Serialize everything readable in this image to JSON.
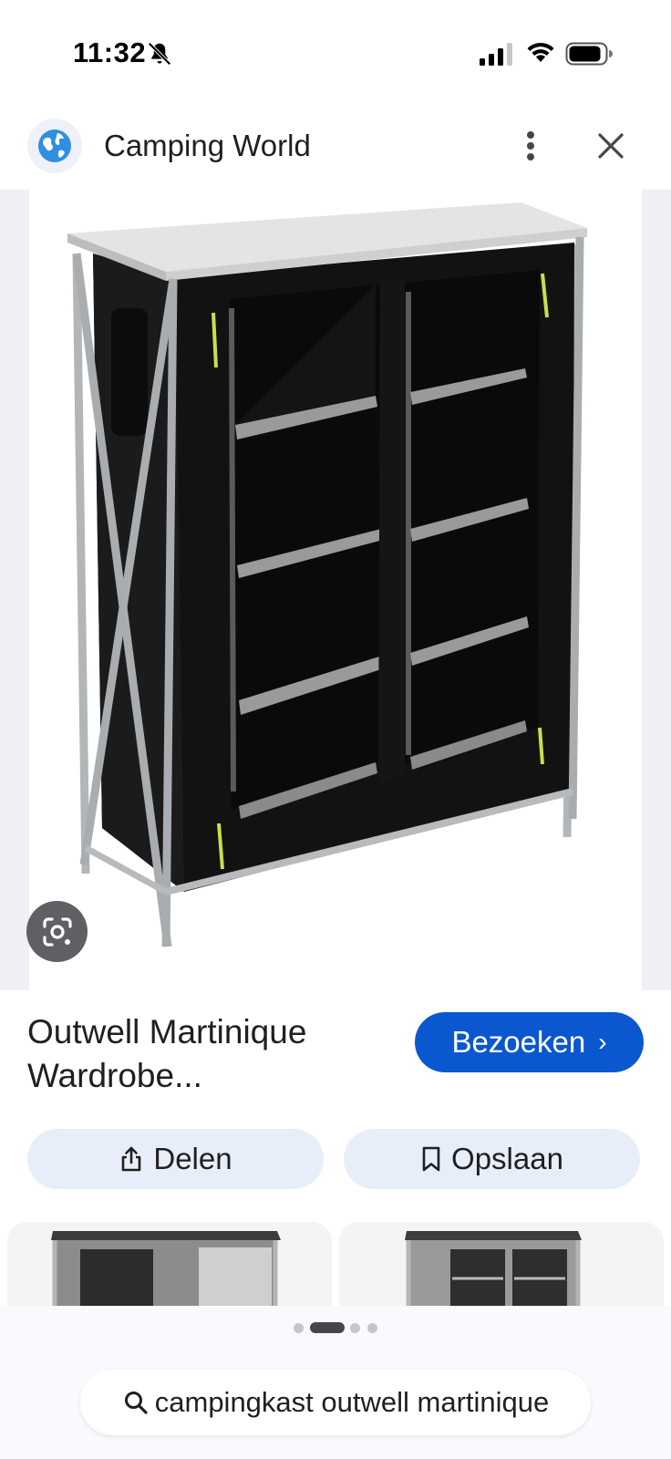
{
  "status_bar": {
    "time": "11:32",
    "icons": [
      "bell-slash-icon",
      "cellular-signal-icon",
      "wifi-icon",
      "battery-icon"
    ]
  },
  "header": {
    "site_name": "Camping World",
    "favicon_icon": "globe-icon",
    "more_icon": "more-vert-icon",
    "close_icon": "close-icon"
  },
  "image": {
    "lens_icon": "google-lens-icon"
  },
  "result": {
    "title": "Outwell Martinique Wardrobe...",
    "visit_label": "Bezoeken",
    "visit_chevron": "›",
    "share_label": "Delen",
    "save_label": "Opslaan"
  },
  "pager": {
    "count": 4,
    "active_index": 1
  },
  "search": {
    "query": "campingkast outwell martinique",
    "icon": "search-icon"
  },
  "colors": {
    "accent": "#0b57d0",
    "pill_background": "#e8eef9",
    "lens_button": "#5f6064"
  }
}
